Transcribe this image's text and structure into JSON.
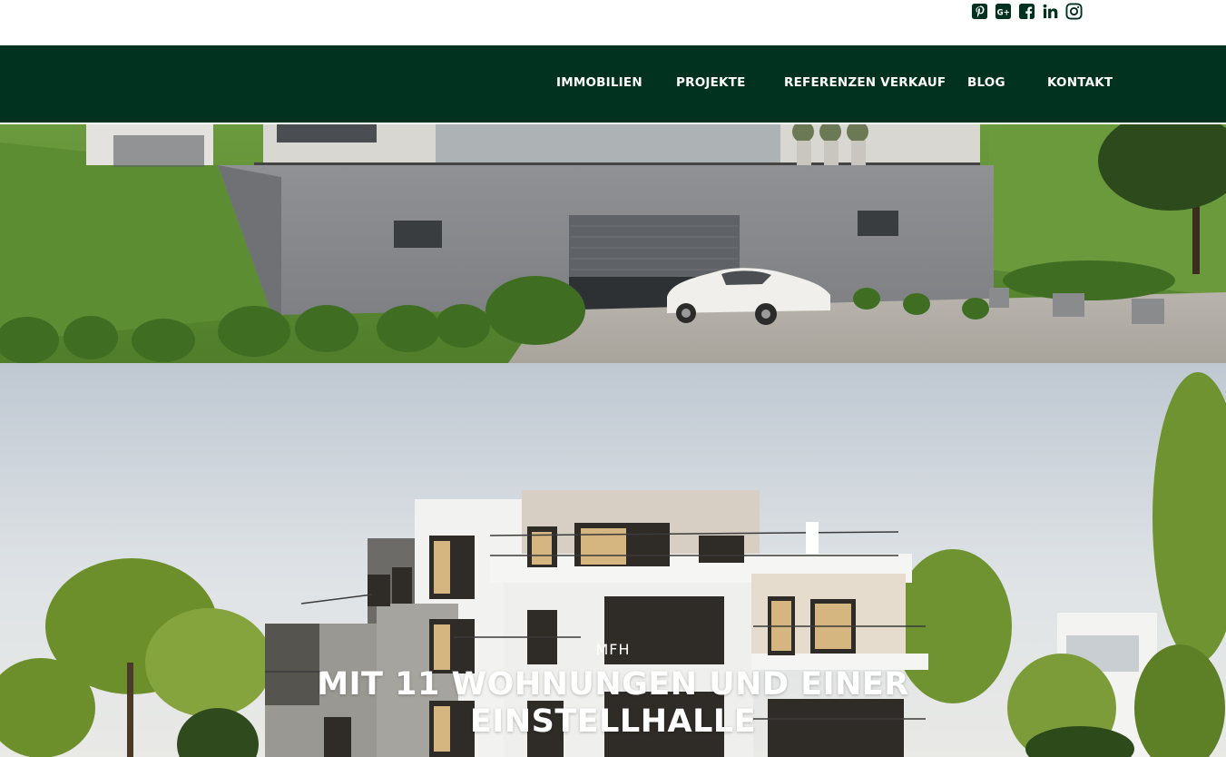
{
  "social": {
    "icons": [
      "pinterest-icon",
      "google-plus-icon",
      "facebook-icon",
      "linkedin-icon",
      "instagram-icon"
    ],
    "color": "#013220"
  },
  "nav": {
    "background": "#013220",
    "items": [
      {
        "label": "IMMOBILIEN"
      },
      {
        "label": "PROJEKTE"
      },
      {
        "label": "REFERENZEN VERKAUF"
      },
      {
        "label": "BLOG"
      },
      {
        "label": "KONTAKT"
      }
    ]
  },
  "hero": {
    "subtitle": "MFH",
    "title_line1": "MIT 11 WOHNUNGEN UND EINER",
    "title_line2": "EINSTELLHALLE"
  }
}
